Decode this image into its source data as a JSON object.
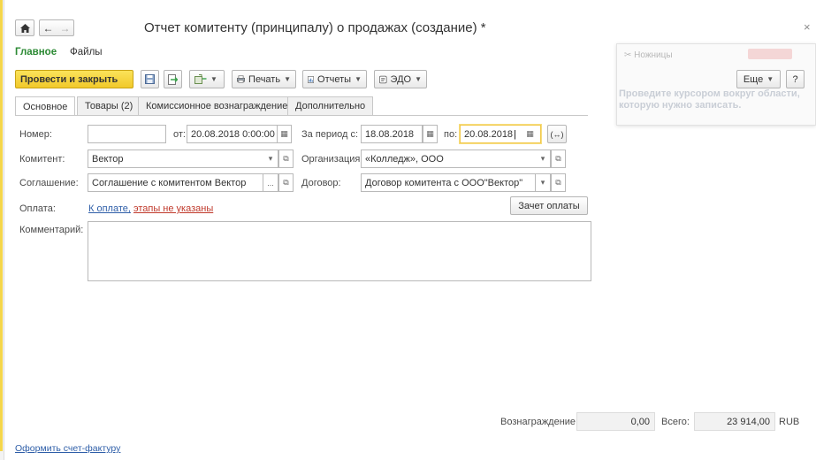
{
  "window": {
    "title": "Отчет комитенту (принципалу) о продажах (создание) *",
    "close_glyph": "×"
  },
  "nav": {
    "home_icon": "home-icon",
    "back_icon": "arrow-left-icon",
    "forward_icon": "arrow-right-icon"
  },
  "sections": {
    "main": "Главное",
    "files": "Файлы"
  },
  "toolbar": {
    "post_close_label": "Провести и закрыть",
    "print_label": "Печать",
    "reports_label": "Отчеты",
    "edo_label": "ЭДО",
    "more_label": "Еще",
    "help_label": "?"
  },
  "tabs": [
    {
      "label": "Основное"
    },
    {
      "label": "Товары (2)"
    },
    {
      "label": "Комиссионное вознаграждение"
    },
    {
      "label": "Дополнительно"
    }
  ],
  "form": {
    "number_label": "Номер:",
    "number_value": "",
    "date_from_label": "от:",
    "date_value": "20.08.2018  0:00:00",
    "period_label": "За период с:",
    "period_from": "18.08.2018",
    "period_to_label": "по:",
    "period_to": "20.08.2018",
    "period_btn": "(↔)",
    "committent_label": "Комитент:",
    "committent_value": "Вектор",
    "org_label": "Организация:",
    "org_value": "«Колледж», ООО",
    "agreement_label": "Соглашение:",
    "agreement_value": "Соглашение с комитентом Вектор",
    "contract_label": "Договор:",
    "contract_value": "Договор комитента с ООО\"Вектор\"",
    "payment_label": "Оплата:",
    "payment_link": "К оплате,",
    "payment_stages": "этапы не указаны",
    "offset_btn": "Зачет оплаты",
    "comment_label": "Комментарий:",
    "comment_value": ""
  },
  "footer": {
    "reward_label": "Вознаграждение:",
    "reward_value": "0,00",
    "total_label": "Всего:",
    "total_value": "23 914,00",
    "currency": "RUB",
    "invoice_link": "Оформить счет-фактуру"
  },
  "overlay": {
    "title": "Ножницы",
    "hint": "Проведите курсором вокруг области, которую нужно записать."
  }
}
